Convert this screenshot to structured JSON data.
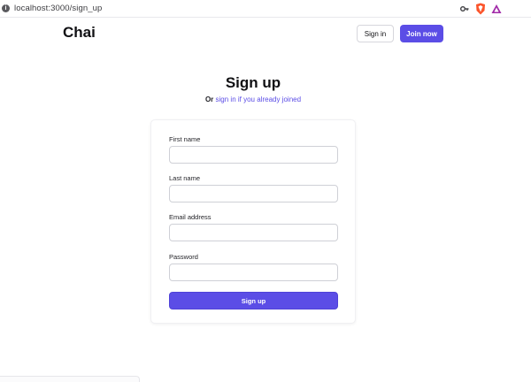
{
  "browser": {
    "url": "localhost:3000/sign_up"
  },
  "navbar": {
    "brand": "Chai",
    "sign_in_label": "Sign in",
    "join_label": "Join now"
  },
  "header": {
    "title": "Sign up",
    "subtitle_prefix": "Or",
    "subtitle_link": "sign in if you already joined"
  },
  "form": {
    "first_name_label": "First name",
    "first_name_value": "",
    "last_name_label": "Last name",
    "last_name_value": "",
    "email_label": "Email address",
    "email_value": "",
    "password_label": "Password",
    "password_value": "",
    "submit_label": "Sign up"
  },
  "colors": {
    "accent": "#5b4de6",
    "text": "#111114",
    "border": "#cfd0d6"
  },
  "icons": {
    "site_info": "info-icon",
    "password_key": "key-icon",
    "brave_shield": "brave-shield-icon",
    "rewards": "rewards-triangle-icon"
  }
}
